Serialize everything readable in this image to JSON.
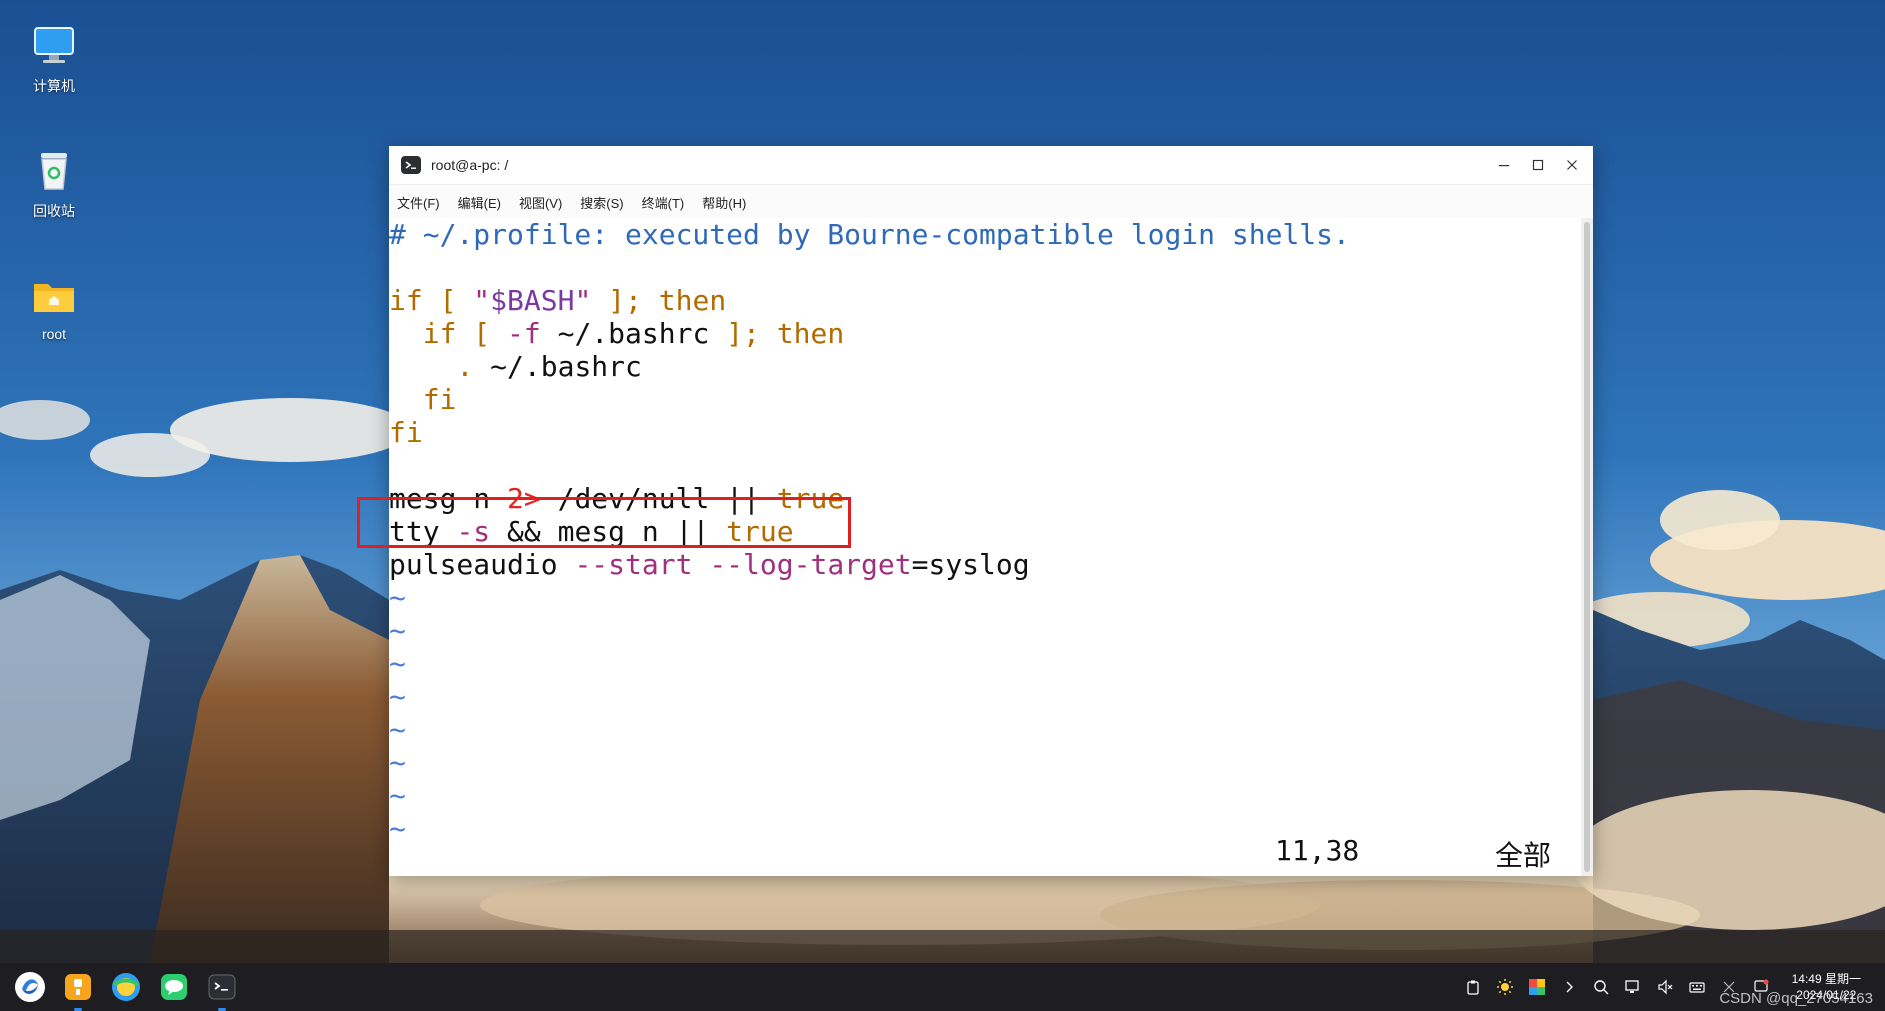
{
  "desktop": {
    "icons": [
      {
        "label": "计算机"
      },
      {
        "label": "回收站"
      },
      {
        "label": "root"
      }
    ]
  },
  "window": {
    "title": "root@a-pc: /",
    "menu": [
      "文件(F)",
      "编辑(E)",
      "视图(V)",
      "搜索(S)",
      "终端(T)",
      "帮助(H)"
    ]
  },
  "editor": {
    "lines": [
      {
        "parts": [
          {
            "t": "# ~/.profile: executed by Bourne-compatible login shells.",
            "c": "c-comment"
          }
        ]
      },
      {
        "parts": []
      },
      {
        "parts": [
          {
            "t": "if",
            "c": "c-kw"
          },
          {
            "t": " [ ",
            "c": "c-kw"
          },
          {
            "t": "\"",
            "c": "c-str"
          },
          {
            "t": "$BASH",
            "c": "c-var"
          },
          {
            "t": "\"",
            "c": "c-str"
          },
          {
            "t": " ]; ",
            "c": "c-kw"
          },
          {
            "t": "then",
            "c": "c-kw"
          }
        ]
      },
      {
        "parts": [
          {
            "t": "  ",
            "c": ""
          },
          {
            "t": "if",
            "c": "c-kw"
          },
          {
            "t": " [ ",
            "c": "c-kw"
          },
          {
            "t": "-f",
            "c": "c-opt"
          },
          {
            "t": " ~/.bashrc ",
            "c": ""
          },
          {
            "t": "]; ",
            "c": "c-kw"
          },
          {
            "t": "then",
            "c": "c-kw"
          }
        ]
      },
      {
        "parts": [
          {
            "t": "    ",
            "c": ""
          },
          {
            "t": ".",
            "c": "c-kw"
          },
          {
            "t": " ~/.bashrc",
            "c": ""
          }
        ]
      },
      {
        "parts": [
          {
            "t": "  ",
            "c": ""
          },
          {
            "t": "fi",
            "c": "c-kw"
          }
        ]
      },
      {
        "parts": [
          {
            "t": "fi",
            "c": "c-kw"
          }
        ]
      },
      {
        "parts": []
      },
      {
        "parts": [
          {
            "t": "mesg n ",
            "c": ""
          },
          {
            "t": "2>",
            "c": "c-red"
          },
          {
            "t": " /dev/null || ",
            "c": ""
          },
          {
            "t": "true",
            "c": "c-kw"
          }
        ]
      },
      {
        "parts": [
          {
            "t": "tty ",
            "c": ""
          },
          {
            "t": "-s",
            "c": "c-opt"
          },
          {
            "t": " && mesg n || ",
            "c": ""
          },
          {
            "t": "true",
            "c": "c-kw"
          }
        ]
      },
      {
        "parts": [
          {
            "t": "pulseaudio ",
            "c": ""
          },
          {
            "t": "--start",
            "c": "c-opt"
          },
          {
            "t": " ",
            "c": ""
          },
          {
            "t": "--log-target",
            "c": "c-opt"
          },
          {
            "t": "=syslog",
            "c": ""
          }
        ]
      },
      {
        "parts": [
          {
            "t": "~",
            "c": "c-tilde"
          }
        ]
      },
      {
        "parts": [
          {
            "t": "~",
            "c": "c-tilde"
          }
        ]
      },
      {
        "parts": [
          {
            "t": "~",
            "c": "c-tilde"
          }
        ]
      },
      {
        "parts": [
          {
            "t": "~",
            "c": "c-tilde"
          }
        ]
      },
      {
        "parts": [
          {
            "t": "~",
            "c": "c-tilde"
          }
        ]
      },
      {
        "parts": [
          {
            "t": "~",
            "c": "c-tilde"
          }
        ]
      },
      {
        "parts": [
          {
            "t": "~",
            "c": "c-tilde"
          }
        ]
      },
      {
        "parts": [
          {
            "t": "~",
            "c": "c-tilde"
          }
        ]
      }
    ],
    "status": {
      "position": "11,38",
      "scope": "全部"
    }
  },
  "taskbar": {
    "apps": [
      {
        "icon": "launcher-icon"
      },
      {
        "icon": "app-store-icon"
      },
      {
        "icon": "browser-icon"
      },
      {
        "icon": "chat-icon"
      },
      {
        "icon": "terminal-icon"
      }
    ],
    "clock": {
      "time": "14:49 星期一",
      "date": "2024/01/22"
    },
    "watermark": "CSDN @qq_27054163"
  },
  "colors": {
    "highlight": "#e02020",
    "taskbar": "#1e1e22",
    "active_dot": "#2e8cf0"
  }
}
